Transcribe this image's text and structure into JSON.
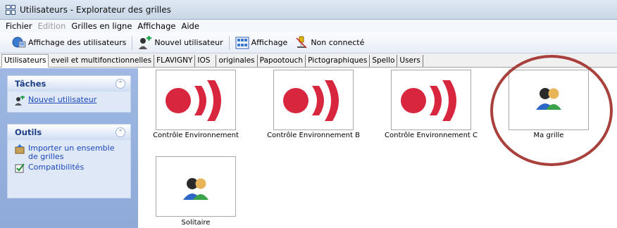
{
  "window": {
    "title": "Utilisateurs - Explorateur des grilles"
  },
  "menu": [
    "Fichier",
    "Edition",
    "Grilles en ligne",
    "Affichage",
    "Aide"
  ],
  "menu_disabled": [
    "Edition"
  ],
  "toolbar": {
    "show_users": "Affichage des utilisateurs",
    "new_user": "Nouvel utilisateur",
    "display": "Affichage",
    "status": "Non connecté"
  },
  "tabs": [
    "Utilisateurs",
    "eveil et multifonctionnelles",
    "FLAVIGNY",
    "IOS",
    "originales",
    "Papootouch",
    "Pictographiques",
    "Spello",
    "Users"
  ],
  "active_tab": "Utilisateurs",
  "sidebar": {
    "tasks": {
      "title": "Tâches",
      "items": [
        "Nouvel utilisateur"
      ]
    },
    "tools": {
      "title": "Outils",
      "items": [
        "Importer un ensemble de grilles",
        "Compatibilités"
      ]
    }
  },
  "grids": [
    {
      "label": "Contrôle Environnement",
      "icon": "speaker-waves-icon"
    },
    {
      "label": "Contrôle Environnement B",
      "icon": "speaker-waves-icon"
    },
    {
      "label": "Contrôle Environnement C",
      "icon": "speaker-waves-icon"
    },
    {
      "label": "Ma grille",
      "icon": "users-icon"
    },
    {
      "label": "Solitaire",
      "icon": "users-icon"
    }
  ],
  "colors": {
    "accent_red": "#d7263d",
    "highlight_ring": "#a8403c",
    "sidebar_bg": "#9eb8e3"
  }
}
